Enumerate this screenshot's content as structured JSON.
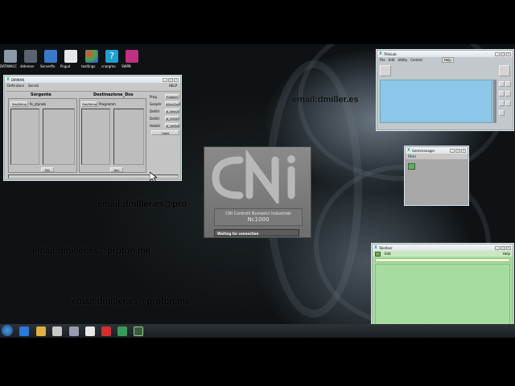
{
  "desktop_icons": [
    {
      "label": "DATIWACC",
      "icon": "wrench-icon",
      "color": "#8a9aa8"
    },
    {
      "label": "didemon",
      "icon": "terminal-icon",
      "color": "#5a6470"
    },
    {
      "label": "Serverftn",
      "icon": "server-icon",
      "color": "#3a78c8"
    },
    {
      "label": "Pcgud",
      "icon": "printer-icon",
      "color": "#e8e8e8"
    },
    {
      "label": "tooltings",
      "icon": "tools-icon",
      "color": "#d04848"
    },
    {
      "label": "cnargmo",
      "icon": "help-icon",
      "color": "#20a0d0"
    },
    {
      "label": "SWPB",
      "icon": "app-icon",
      "color": "#c03080"
    }
  ],
  "watermarks": [
    "email:dmiller.es",
    "email:dmiller.es@pro",
    "email:dmiller.es@proton.me",
    "email:dmiller.es@proton.me"
  ],
  "dirman": {
    "title": "DIRMAN",
    "menu": [
      "Definizioni",
      "Servizi"
    ],
    "help": "HELP",
    "source_header": "Sorgente",
    "dest_header": "Destinazione_Dos",
    "source_btn": "Seq/Setup",
    "source_path": "fe_ytpnob",
    "dest_btn": "Des/Setup",
    "dest_path": "Programm",
    "source_sel": "Nnl",
    "dest_sel": "Nnn",
    "right_labels": [
      "Prog",
      "Sorqdir",
      "Defdir",
      "Defdir",
      "Hebdir"
    ],
    "right_buttons": [
      "Prodbkfc",
      "dServ2sv3",
      "id_Vedr2s",
      "id_Vd3d3",
      "id_Vef8d3"
    ],
    "copy": "Copia"
  },
  "cni_splash": {
    "name": "CNI Controlli Numerici Industriali",
    "model": "Nc1000",
    "status": "Waiting for connection"
  },
  "blue_win": {
    "title": "TitleLab",
    "menu": [
      "File",
      "Edit",
      "Utility",
      "Control"
    ],
    "tab": "Help"
  },
  "gray_win": {
    "title": "Gemimanager",
    "menu": [
      "Fil(e)"
    ]
  },
  "green_win": {
    "title": "TeleXser",
    "menu": [
      "Edit"
    ],
    "help": "Help"
  },
  "taskbar": {
    "start_icon": "windows-start-icon"
  }
}
